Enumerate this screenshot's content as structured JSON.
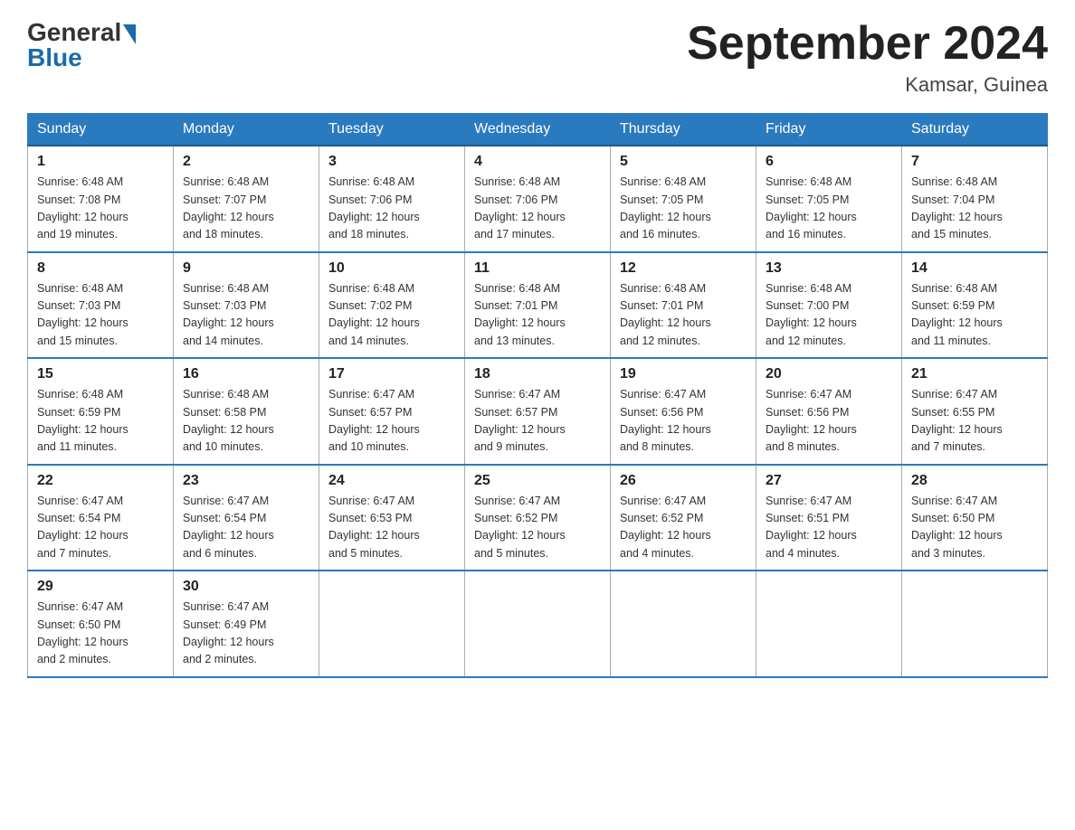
{
  "header": {
    "logo_general": "General",
    "logo_blue": "Blue",
    "month_year": "September 2024",
    "location": "Kamsar, Guinea"
  },
  "columns": [
    "Sunday",
    "Monday",
    "Tuesday",
    "Wednesday",
    "Thursday",
    "Friday",
    "Saturday"
  ],
  "weeks": [
    [
      {
        "day": "1",
        "sunrise": "6:48 AM",
        "sunset": "7:08 PM",
        "daylight": "12 hours and 19 minutes."
      },
      {
        "day": "2",
        "sunrise": "6:48 AM",
        "sunset": "7:07 PM",
        "daylight": "12 hours and 18 minutes."
      },
      {
        "day": "3",
        "sunrise": "6:48 AM",
        "sunset": "7:06 PM",
        "daylight": "12 hours and 18 minutes."
      },
      {
        "day": "4",
        "sunrise": "6:48 AM",
        "sunset": "7:06 PM",
        "daylight": "12 hours and 17 minutes."
      },
      {
        "day": "5",
        "sunrise": "6:48 AM",
        "sunset": "7:05 PM",
        "daylight": "12 hours and 16 minutes."
      },
      {
        "day": "6",
        "sunrise": "6:48 AM",
        "sunset": "7:05 PM",
        "daylight": "12 hours and 16 minutes."
      },
      {
        "day": "7",
        "sunrise": "6:48 AM",
        "sunset": "7:04 PM",
        "daylight": "12 hours and 15 minutes."
      }
    ],
    [
      {
        "day": "8",
        "sunrise": "6:48 AM",
        "sunset": "7:03 PM",
        "daylight": "12 hours and 15 minutes."
      },
      {
        "day": "9",
        "sunrise": "6:48 AM",
        "sunset": "7:03 PM",
        "daylight": "12 hours and 14 minutes."
      },
      {
        "day": "10",
        "sunrise": "6:48 AM",
        "sunset": "7:02 PM",
        "daylight": "12 hours and 14 minutes."
      },
      {
        "day": "11",
        "sunrise": "6:48 AM",
        "sunset": "7:01 PM",
        "daylight": "12 hours and 13 minutes."
      },
      {
        "day": "12",
        "sunrise": "6:48 AM",
        "sunset": "7:01 PM",
        "daylight": "12 hours and 12 minutes."
      },
      {
        "day": "13",
        "sunrise": "6:48 AM",
        "sunset": "7:00 PM",
        "daylight": "12 hours and 12 minutes."
      },
      {
        "day": "14",
        "sunrise": "6:48 AM",
        "sunset": "6:59 PM",
        "daylight": "12 hours and 11 minutes."
      }
    ],
    [
      {
        "day": "15",
        "sunrise": "6:48 AM",
        "sunset": "6:59 PM",
        "daylight": "12 hours and 11 minutes."
      },
      {
        "day": "16",
        "sunrise": "6:48 AM",
        "sunset": "6:58 PM",
        "daylight": "12 hours and 10 minutes."
      },
      {
        "day": "17",
        "sunrise": "6:47 AM",
        "sunset": "6:57 PM",
        "daylight": "12 hours and 10 minutes."
      },
      {
        "day": "18",
        "sunrise": "6:47 AM",
        "sunset": "6:57 PM",
        "daylight": "12 hours and 9 minutes."
      },
      {
        "day": "19",
        "sunrise": "6:47 AM",
        "sunset": "6:56 PM",
        "daylight": "12 hours and 8 minutes."
      },
      {
        "day": "20",
        "sunrise": "6:47 AM",
        "sunset": "6:56 PM",
        "daylight": "12 hours and 8 minutes."
      },
      {
        "day": "21",
        "sunrise": "6:47 AM",
        "sunset": "6:55 PM",
        "daylight": "12 hours and 7 minutes."
      }
    ],
    [
      {
        "day": "22",
        "sunrise": "6:47 AM",
        "sunset": "6:54 PM",
        "daylight": "12 hours and 7 minutes."
      },
      {
        "day": "23",
        "sunrise": "6:47 AM",
        "sunset": "6:54 PM",
        "daylight": "12 hours and 6 minutes."
      },
      {
        "day": "24",
        "sunrise": "6:47 AM",
        "sunset": "6:53 PM",
        "daylight": "12 hours and 5 minutes."
      },
      {
        "day": "25",
        "sunrise": "6:47 AM",
        "sunset": "6:52 PM",
        "daylight": "12 hours and 5 minutes."
      },
      {
        "day": "26",
        "sunrise": "6:47 AM",
        "sunset": "6:52 PM",
        "daylight": "12 hours and 4 minutes."
      },
      {
        "day": "27",
        "sunrise": "6:47 AM",
        "sunset": "6:51 PM",
        "daylight": "12 hours and 4 minutes."
      },
      {
        "day": "28",
        "sunrise": "6:47 AM",
        "sunset": "6:50 PM",
        "daylight": "12 hours and 3 minutes."
      }
    ],
    [
      {
        "day": "29",
        "sunrise": "6:47 AM",
        "sunset": "6:50 PM",
        "daylight": "12 hours and 2 minutes."
      },
      {
        "day": "30",
        "sunrise": "6:47 AM",
        "sunset": "6:49 PM",
        "daylight": "12 hours and 2 minutes."
      },
      null,
      null,
      null,
      null,
      null
    ]
  ]
}
